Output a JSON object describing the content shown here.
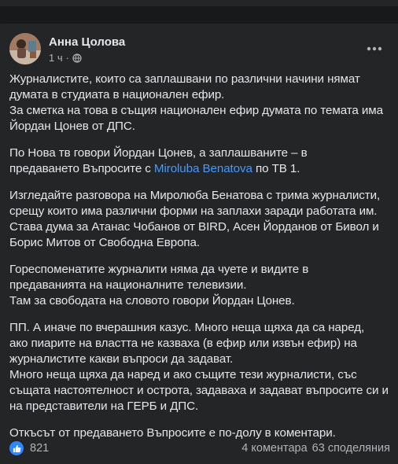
{
  "post": {
    "author": "Анна Цолова",
    "time": "1 ч",
    "separator": "·",
    "paragraphs": [
      {
        "lines": [
          "Журналистите, които са заплашвани по различни начини нямат",
          "думата в студиата в национален ефир.",
          "За сметка на това в същия национален ефир думата по темата има",
          "Йордан Цонев от ДПС."
        ]
      },
      {
        "lines": [
          "По Нова тв говори Йордан Цонев, а заплашваните – в"
        ],
        "mention_line": {
          "before": "предаването Въпросите с ",
          "mention": "Miroluba Benatova",
          "after": " по ТВ 1."
        }
      },
      {
        "lines": [
          "Изгледайте разговора на Миролюба Бенатова с трима журналисти,",
          "срещу които има различни форми на заплахи заради работата им.",
          "Става дума за Атанас Чобанов от BIRD, Асен Йорданов от Бивол и",
          "Борис Митов от Свободна Европа."
        ]
      },
      {
        "lines": [
          "Гореспоменатите журналити няма да чуете и видите в",
          "предаванията на националните телевизии.",
          "Там за свободата на словото говори Йордан Цонев."
        ]
      },
      {
        "lines": [
          "ПП. А иначе по вчерашния казус. Много неща щяха да са наред,",
          "ако пиарите на властта не казваха (в ефир или извън ефир) на",
          "журналистите какви въпроси да задават.",
          "Много неща щяха да наред и ако същите тези журналисти, със",
          "същата настоятелност и острота, задаваха и задават въпросите си и",
          "на представители на ГЕРБ и ДПС."
        ]
      },
      {
        "lines": [
          "Откъсът от предаването Въпросите е по-долу в коментари."
        ]
      }
    ],
    "reactions_count": "821",
    "comments_count": "4 коментара",
    "shares_count": "63 споделяния",
    "icons": {
      "privacy": "globe-icon",
      "menu": "more-options-icon",
      "reaction": "like-icon"
    },
    "colors": {
      "background": "#242526",
      "text": "#e4e6eb",
      "secondary_text": "#b0b3b8",
      "mention": "#4599ff",
      "like_blue": "#2d88ff"
    }
  }
}
